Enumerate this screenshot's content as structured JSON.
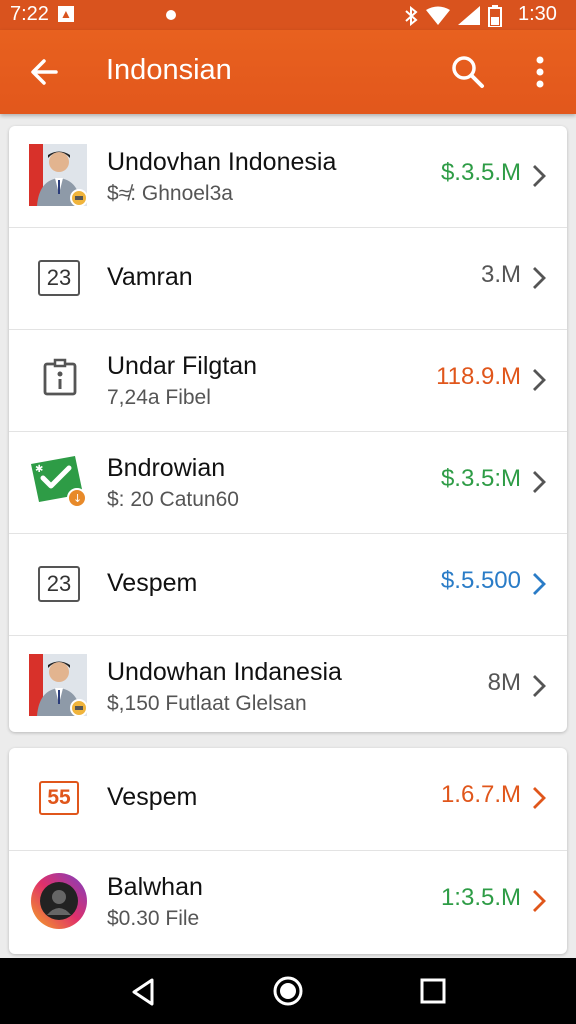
{
  "status_bar": {
    "time": "7:22",
    "notification_glyph": "▲",
    "clock": "1:30",
    "icons": [
      "bluetooth-icon",
      "wifi-icon",
      "signal-icon",
      "battery-icon"
    ]
  },
  "app_bar": {
    "title": "Indonsian",
    "color": "#e2591c"
  },
  "rows": [
    {
      "title": "Undovhan Indonesia",
      "subtitle": "$≉: Ghnoel3a",
      "value": "$.3.5.M",
      "value_color": "#2e9c46",
      "icon": "person-avatar-icon"
    },
    {
      "title": "Vamran",
      "subtitle": "",
      "value": "3.M",
      "value_color": "#555555",
      "icon": "calendar-23-icon",
      "icon_text": "23"
    },
    {
      "title": "Undar Filgtan",
      "subtitle": "7,24a Fibel",
      "value": "118.9.M",
      "value_color": "#e0561b",
      "icon": "clipboard-icon"
    },
    {
      "title": "Bndrowian",
      "subtitle": "$: 20 Catun60",
      "value": "$.3.5:M",
      "value_color": "#2e9c46",
      "icon": "green-check-ticket-icon"
    },
    {
      "title": "Vespem",
      "subtitle": "",
      "value": "$.5.500",
      "value_color": "#2a7cc7",
      "icon": "calendar-23-icon",
      "icon_text": "23"
    },
    {
      "title": "Undowhan Indanesia",
      "subtitle": "$,150 Futlaat Glelsan",
      "value": "8M",
      "value_color": "#555555",
      "icon": "person-avatar-icon"
    },
    {
      "title": "Vespem",
      "subtitle": "",
      "value": "1.6.7.M",
      "value_color": "#e0561b",
      "icon": "calendar-55-icon",
      "icon_text": "55"
    },
    {
      "title": "Balwhan",
      "subtitle": "$0.30 File",
      "value": "1:3.5.M",
      "value_color": "#2e9c46",
      "icon": "gradient-avatar-icon"
    }
  ]
}
